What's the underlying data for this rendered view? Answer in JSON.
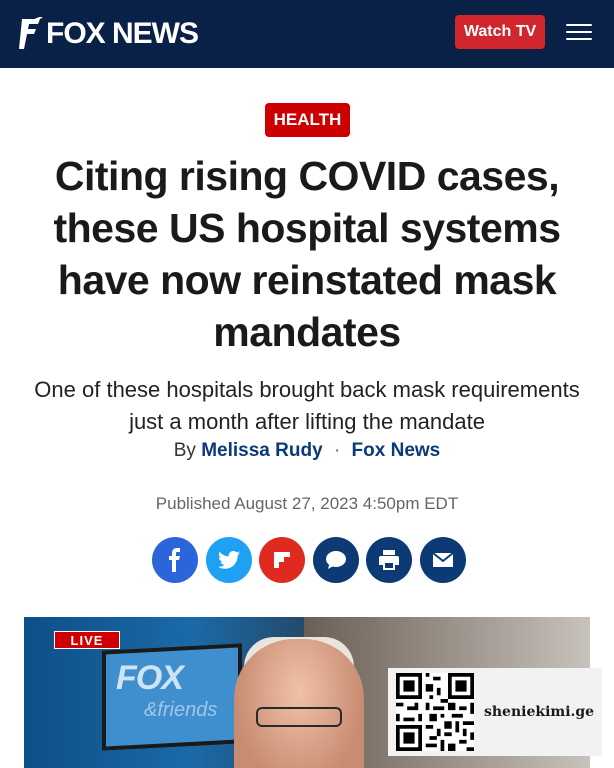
{
  "header": {
    "logo_text": "FOX NEWS",
    "watch_label": "Watch TV",
    "menu_icon": "menu-icon",
    "colors": {
      "bar": "#0a2147",
      "watch": "#d2262f"
    }
  },
  "article": {
    "category": "HEALTH",
    "headline": "Citing rising COVID cases, these US hospital systems have now reinstated mask mandates",
    "subhead": "One of these hospitals brought back mask requirements just a month after lifting the mandate",
    "by_prefix": "By",
    "author": "Melissa Rudy",
    "separator": "·",
    "source": "Fox News",
    "published": "Published August 27, 2023 4:50pm EDT"
  },
  "share": [
    {
      "icon": "facebook-icon",
      "color": "#2b65d9"
    },
    {
      "icon": "twitter-icon",
      "color": "#1da1f2"
    },
    {
      "icon": "flipboard-icon",
      "color": "#e02a20"
    },
    {
      "icon": "comment-icon",
      "color": "#0b3a74"
    },
    {
      "icon": "print-icon",
      "color": "#0b3a74"
    },
    {
      "icon": "email-icon",
      "color": "#0b3a74"
    }
  ],
  "video": {
    "live_label": "LIVE",
    "screen_text": "FOX",
    "screen_sub": "&friends"
  },
  "watermark": {
    "site": "sheniekimi.ge",
    "icon": "qr-code-icon"
  }
}
